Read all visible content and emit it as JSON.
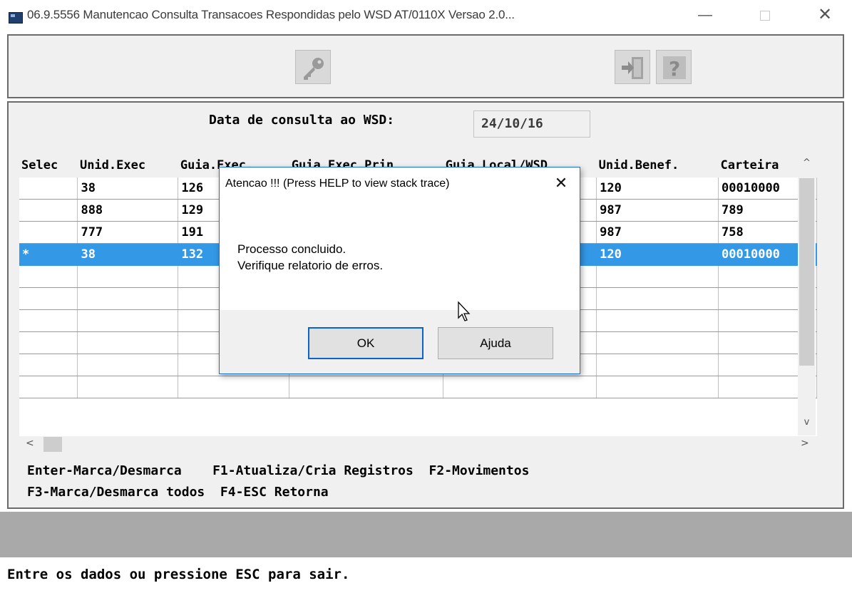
{
  "window": {
    "title": "06.9.5556 Manutencao  Consulta Transacoes Respondidas pelo WSD AT/0110X Versao 2.0...",
    "minimize_glyph": "—",
    "close_glyph": "✕"
  },
  "toolbar": {
    "icons": [
      "key-icon",
      "exit-door-icon",
      "help-question-icon"
    ],
    "help_glyph": "?"
  },
  "form": {
    "date_label": "Data de consulta ao WSD:",
    "date_value": "24/10/16"
  },
  "grid": {
    "columns": [
      "Selec",
      "Unid.Exec",
      "Guia.Exec.",
      "Guia.Exec.Prin",
      "Guia.Local/WSD",
      "Unid.Benef.",
      "Carteira"
    ],
    "rows": [
      {
        "selec": "",
        "unid_exec": "38",
        "guia_exec": "126",
        "guia_exec_prin": "",
        "guia_local": "",
        "unid_benef": "120",
        "carteira": "00010000"
      },
      {
        "selec": "",
        "unid_exec": "888",
        "guia_exec": "129",
        "guia_exec_prin": "",
        "guia_local": "",
        "unid_benef": "987",
        "carteira": "789"
      },
      {
        "selec": "",
        "unid_exec": "777",
        "guia_exec": "191",
        "guia_exec_prin": "",
        "guia_local": "",
        "unid_benef": "987",
        "carteira": "758"
      },
      {
        "selec": "*",
        "unid_exec": "38",
        "guia_exec": "132",
        "guia_exec_prin": "",
        "guia_local": "",
        "unid_benef": "120",
        "carteira": "00010000"
      }
    ],
    "empty_rows": 6,
    "selected_row_color": "#3398e6"
  },
  "scroll": {
    "up": "^",
    "down": "v",
    "left": "<",
    "right": ">"
  },
  "help_text": {
    "line1": "Enter-Marca/Desmarca    F1-Atualiza/Cria Registros  F2-Movimentos",
    "line2": "F3-Marca/Desmarca todos  F4-ESC Retorna"
  },
  "status_line": "Entre os dados ou pressione ESC para sair.",
  "dialog": {
    "title": "Atencao !!! (Press HELP to view stack trace)",
    "close_glyph": "✕",
    "message_line1": "Processo concluido.",
    "message_line2": "Verifique relatorio de erros.",
    "ok_label": "OK",
    "help_label": "Ajuda",
    "accent_color": "#0a64c8"
  }
}
